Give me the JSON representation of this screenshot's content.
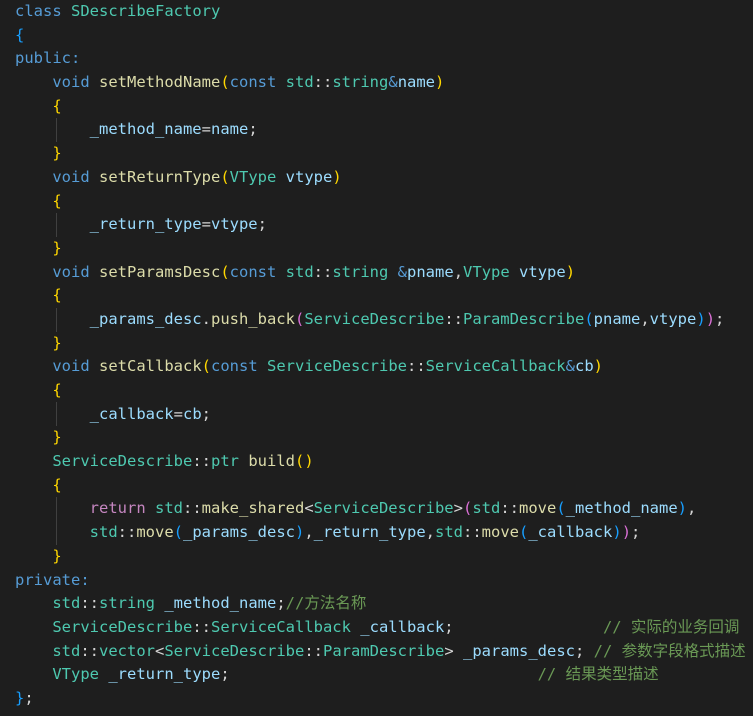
{
  "editor": {
    "language": "C++",
    "theme": "Dark+",
    "colors": {
      "background": "#1e1e1e",
      "keyword": "#569cd6",
      "type": "#4ec9b0",
      "function": "#dcdcaa",
      "variable": "#9cdcfe",
      "plain": "#d4d4d4",
      "comment": "#6a9955",
      "bracket_level_1": "#ffd700",
      "bracket_level_2": "#da70d6",
      "bracket_level_3": "#179fff",
      "control": "#c586c0"
    },
    "lines": [
      [
        {
          "t": "class ",
          "c": "kw"
        },
        {
          "t": "SDescribeFactory",
          "c": "ty"
        }
      ],
      [
        {
          "t": "{",
          "c": "b3"
        }
      ],
      [
        {
          "t": "public:",
          "c": "kw"
        }
      ],
      [
        {
          "t": "    "
        },
        {
          "t": "void ",
          "c": "kw"
        },
        {
          "t": "setMethodName",
          "c": "fn"
        },
        {
          "t": "(",
          "c": "b1"
        },
        {
          "t": "const ",
          "c": "kw"
        },
        {
          "t": "std",
          "c": "ty"
        },
        {
          "t": "::",
          "c": "pl"
        },
        {
          "t": "string",
          "c": "ty"
        },
        {
          "t": "&",
          "c": "kw"
        },
        {
          "t": "name",
          "c": "va"
        },
        {
          "t": ")",
          "c": "b1"
        }
      ],
      [
        {
          "t": "    "
        },
        {
          "t": "{",
          "c": "b1"
        }
      ],
      [
        {
          "t": "        "
        },
        {
          "t": "_method_name",
          "c": "va"
        },
        {
          "t": "=",
          "c": "pl"
        },
        {
          "t": "name",
          "c": "va"
        },
        {
          "t": ";",
          "c": "pl"
        }
      ],
      [
        {
          "t": "    "
        },
        {
          "t": "}",
          "c": "b1"
        }
      ],
      [
        {
          "t": "    "
        },
        {
          "t": "void ",
          "c": "kw"
        },
        {
          "t": "setReturnType",
          "c": "fn"
        },
        {
          "t": "(",
          "c": "b1"
        },
        {
          "t": "VType ",
          "c": "ty"
        },
        {
          "t": "vtype",
          "c": "va"
        },
        {
          "t": ")",
          "c": "b1"
        }
      ],
      [
        {
          "t": "    "
        },
        {
          "t": "{",
          "c": "b1"
        }
      ],
      [
        {
          "t": "        "
        },
        {
          "t": "_return_type",
          "c": "va"
        },
        {
          "t": "=",
          "c": "pl"
        },
        {
          "t": "vtype",
          "c": "va"
        },
        {
          "t": ";",
          "c": "pl"
        }
      ],
      [
        {
          "t": "    "
        },
        {
          "t": "}",
          "c": "b1"
        }
      ],
      [
        {
          "t": "    "
        },
        {
          "t": "void ",
          "c": "kw"
        },
        {
          "t": "setParamsDesc",
          "c": "fn"
        },
        {
          "t": "(",
          "c": "b1"
        },
        {
          "t": "const ",
          "c": "kw"
        },
        {
          "t": "std",
          "c": "ty"
        },
        {
          "t": "::",
          "c": "pl"
        },
        {
          "t": "string ",
          "c": "ty"
        },
        {
          "t": "&",
          "c": "kw"
        },
        {
          "t": "pname",
          "c": "va"
        },
        {
          "t": ",",
          "c": "pl"
        },
        {
          "t": "VType ",
          "c": "ty"
        },
        {
          "t": "vtype",
          "c": "va"
        },
        {
          "t": ")",
          "c": "b1"
        }
      ],
      [
        {
          "t": "    "
        },
        {
          "t": "{",
          "c": "b1"
        }
      ],
      [
        {
          "t": "        "
        },
        {
          "t": "_params_desc",
          "c": "va"
        },
        {
          "t": ".",
          "c": "pl"
        },
        {
          "t": "push_back",
          "c": "fn"
        },
        {
          "t": "(",
          "c": "b2"
        },
        {
          "t": "ServiceDescribe",
          "c": "ty"
        },
        {
          "t": "::",
          "c": "pl"
        },
        {
          "t": "ParamDescribe",
          "c": "ty"
        },
        {
          "t": "(",
          "c": "b3"
        },
        {
          "t": "pname",
          "c": "va"
        },
        {
          "t": ",",
          "c": "pl"
        },
        {
          "t": "vtype",
          "c": "va"
        },
        {
          "t": ")",
          "c": "b3"
        },
        {
          "t": ")",
          "c": "b2"
        },
        {
          "t": ";",
          "c": "pl"
        }
      ],
      [
        {
          "t": "    "
        },
        {
          "t": "}",
          "c": "b1"
        }
      ],
      [
        {
          "t": "    "
        },
        {
          "t": "void ",
          "c": "kw"
        },
        {
          "t": "setCallback",
          "c": "fn"
        },
        {
          "t": "(",
          "c": "b1"
        },
        {
          "t": "const ",
          "c": "kw"
        },
        {
          "t": "ServiceDescribe",
          "c": "ty"
        },
        {
          "t": "::",
          "c": "pl"
        },
        {
          "t": "ServiceCallback",
          "c": "ty"
        },
        {
          "t": "&",
          "c": "kw"
        },
        {
          "t": "cb",
          "c": "va"
        },
        {
          "t": ")",
          "c": "b1"
        }
      ],
      [
        {
          "t": "    "
        },
        {
          "t": "{",
          "c": "b1"
        }
      ],
      [
        {
          "t": "        "
        },
        {
          "t": "_callback",
          "c": "va"
        },
        {
          "t": "=",
          "c": "pl"
        },
        {
          "t": "cb",
          "c": "va"
        },
        {
          "t": ";",
          "c": "pl"
        }
      ],
      [
        {
          "t": "    "
        },
        {
          "t": "}",
          "c": "b1"
        }
      ],
      [
        {
          "t": "    "
        },
        {
          "t": "ServiceDescribe",
          "c": "ty"
        },
        {
          "t": "::",
          "c": "pl"
        },
        {
          "t": "ptr ",
          "c": "ty"
        },
        {
          "t": "build",
          "c": "fn"
        },
        {
          "t": "()",
          "c": "b1"
        }
      ],
      [
        {
          "t": "    "
        },
        {
          "t": "{",
          "c": "b1"
        }
      ],
      [
        {
          "t": "        "
        },
        {
          "t": "return ",
          "c": "ctl"
        },
        {
          "t": "std",
          "c": "ty"
        },
        {
          "t": "::",
          "c": "pl"
        },
        {
          "t": "make_shared",
          "c": "fn"
        },
        {
          "t": "<",
          "c": "pl"
        },
        {
          "t": "ServiceDescribe",
          "c": "ty"
        },
        {
          "t": ">",
          "c": "pl"
        },
        {
          "t": "(",
          "c": "b2"
        },
        {
          "t": "std",
          "c": "ty"
        },
        {
          "t": "::",
          "c": "pl"
        },
        {
          "t": "move",
          "c": "fn"
        },
        {
          "t": "(",
          "c": "b3"
        },
        {
          "t": "_method_name",
          "c": "va"
        },
        {
          "t": ")",
          "c": "b3"
        },
        {
          "t": ",",
          "c": "pl"
        }
      ],
      [
        {
          "t": "        "
        },
        {
          "t": "std",
          "c": "ty"
        },
        {
          "t": "::",
          "c": "pl"
        },
        {
          "t": "move",
          "c": "fn"
        },
        {
          "t": "(",
          "c": "b3"
        },
        {
          "t": "_params_desc",
          "c": "va"
        },
        {
          "t": ")",
          "c": "b3"
        },
        {
          "t": ",",
          "c": "pl"
        },
        {
          "t": "_return_type",
          "c": "va"
        },
        {
          "t": ",",
          "c": "pl"
        },
        {
          "t": "std",
          "c": "ty"
        },
        {
          "t": "::",
          "c": "pl"
        },
        {
          "t": "move",
          "c": "fn"
        },
        {
          "t": "(",
          "c": "b3"
        },
        {
          "t": "_callback",
          "c": "va"
        },
        {
          "t": ")",
          "c": "b3"
        },
        {
          "t": ")",
          "c": "b2"
        },
        {
          "t": ";",
          "c": "pl"
        }
      ],
      [
        {
          "t": "    "
        },
        {
          "t": "}",
          "c": "b1"
        }
      ],
      [
        {
          "t": "private:",
          "c": "kw"
        }
      ],
      [
        {
          "t": "    "
        },
        {
          "t": "std",
          "c": "ty"
        },
        {
          "t": "::",
          "c": "pl"
        },
        {
          "t": "string ",
          "c": "ty"
        },
        {
          "t": "_method_name",
          "c": "va"
        },
        {
          "t": ";",
          "c": "pl"
        },
        {
          "t": "//方法名称",
          "c": "cm"
        }
      ],
      [
        {
          "t": "    "
        },
        {
          "t": "ServiceDescribe",
          "c": "ty"
        },
        {
          "t": "::",
          "c": "pl"
        },
        {
          "t": "ServiceCallback ",
          "c": "ty"
        },
        {
          "t": "_callback",
          "c": "va"
        },
        {
          "t": ";                ",
          "c": "pl"
        },
        {
          "t": "// 实际的业务回调",
          "c": "cm"
        }
      ],
      [
        {
          "t": "    "
        },
        {
          "t": "std",
          "c": "ty"
        },
        {
          "t": "::",
          "c": "pl"
        },
        {
          "t": "vector",
          "c": "ty"
        },
        {
          "t": "<",
          "c": "pl"
        },
        {
          "t": "ServiceDescribe",
          "c": "ty"
        },
        {
          "t": "::",
          "c": "pl"
        },
        {
          "t": "ParamDescribe",
          "c": "ty"
        },
        {
          "t": "> ",
          "c": "pl"
        },
        {
          "t": "_params_desc",
          "c": "va"
        },
        {
          "t": "; ",
          "c": "pl"
        },
        {
          "t": "// 参数字段格式描述",
          "c": "cm"
        }
      ],
      [
        {
          "t": "    "
        },
        {
          "t": "VType ",
          "c": "ty"
        },
        {
          "t": "_return_type",
          "c": "va"
        },
        {
          "t": ";                                 ",
          "c": "pl"
        },
        {
          "t": "// 结果类型描述",
          "c": "cm"
        }
      ],
      [
        {
          "t": "}",
          "c": "b3"
        },
        {
          "t": ";",
          "c": "pl"
        }
      ]
    ]
  }
}
